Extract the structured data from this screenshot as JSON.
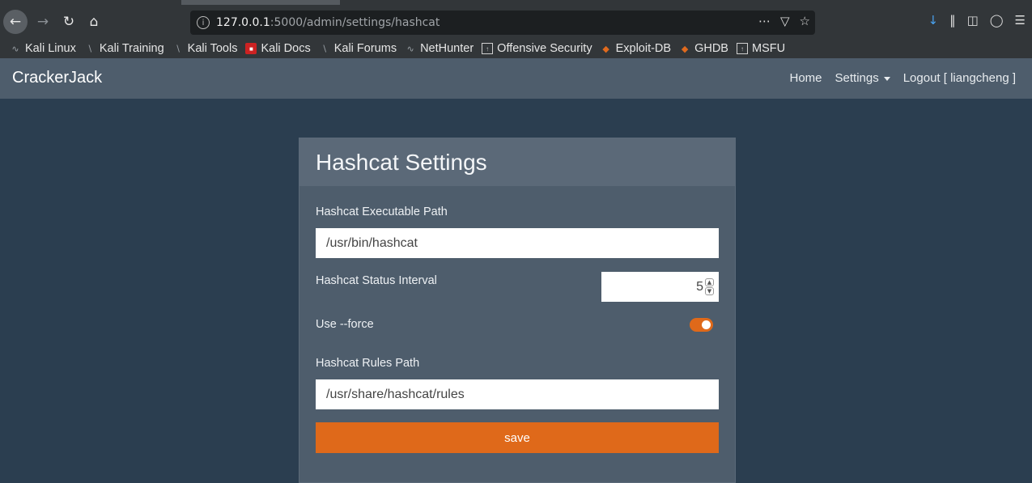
{
  "browser": {
    "url_host": "127.0.0.1",
    "url_path": ":5000/admin/settings/hashcat",
    "bookmarks": [
      {
        "label": "Kali Linux"
      },
      {
        "label": "Kali Training"
      },
      {
        "label": "Kali Tools"
      },
      {
        "label": "Kali Docs"
      },
      {
        "label": "Kali Forums"
      },
      {
        "label": "NetHunter"
      },
      {
        "label": "Offensive Security"
      },
      {
        "label": "Exploit-DB"
      },
      {
        "label": "GHDB"
      },
      {
        "label": "MSFU"
      }
    ]
  },
  "navbar": {
    "brand": "CrackerJack",
    "home": "Home",
    "settings": "Settings",
    "logout": "Logout [ liangcheng ]"
  },
  "form": {
    "title": "Hashcat Settings",
    "exec_label": "Hashcat Executable Path",
    "exec_value": "/usr/bin/hashcat",
    "interval_label": "Hashcat Status Interval",
    "interval_value": "5",
    "force_label": "Use --force",
    "force_enabled": true,
    "rules_label": "Hashcat Rules Path",
    "rules_value": "/usr/share/hashcat/rules",
    "save_label": "save"
  },
  "colors": {
    "accent": "#df691a",
    "background": "#2b3e50",
    "panel": "#4e5d6c"
  }
}
